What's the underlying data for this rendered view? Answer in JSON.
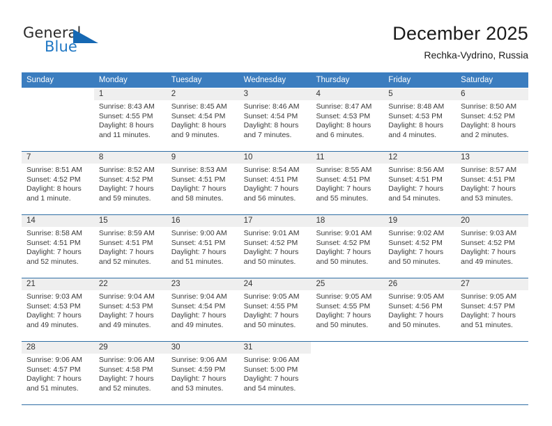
{
  "brand": {
    "word_one": "General",
    "word_two": "Blue",
    "logo_icon": "triangle-logo-icon",
    "accent_color": "#1668b3"
  },
  "header": {
    "title": "December 2025",
    "subtitle": "Rechka-Vydrino, Russia"
  },
  "theme": {
    "header_blue": "#3b7dbf",
    "rule_blue": "#2e6da4",
    "daynum_band": "#efefef",
    "text": "#3a3a3a"
  },
  "weekdays": [
    "Sunday",
    "Monday",
    "Tuesday",
    "Wednesday",
    "Thursday",
    "Friday",
    "Saturday"
  ],
  "weeks": [
    [
      {
        "day": "",
        "sunrise": "",
        "sunset": "",
        "daylight_line1": "",
        "daylight_line2": "",
        "empty": true
      },
      {
        "day": "1",
        "sunrise": "Sunrise: 8:43 AM",
        "sunset": "Sunset: 4:55 PM",
        "daylight_line1": "Daylight: 8 hours",
        "daylight_line2": "and 11 minutes."
      },
      {
        "day": "2",
        "sunrise": "Sunrise: 8:45 AM",
        "sunset": "Sunset: 4:54 PM",
        "daylight_line1": "Daylight: 8 hours",
        "daylight_line2": "and 9 minutes."
      },
      {
        "day": "3",
        "sunrise": "Sunrise: 8:46 AM",
        "sunset": "Sunset: 4:54 PM",
        "daylight_line1": "Daylight: 8 hours",
        "daylight_line2": "and 7 minutes."
      },
      {
        "day": "4",
        "sunrise": "Sunrise: 8:47 AM",
        "sunset": "Sunset: 4:53 PM",
        "daylight_line1": "Daylight: 8 hours",
        "daylight_line2": "and 6 minutes."
      },
      {
        "day": "5",
        "sunrise": "Sunrise: 8:48 AM",
        "sunset": "Sunset: 4:53 PM",
        "daylight_line1": "Daylight: 8 hours",
        "daylight_line2": "and 4 minutes."
      },
      {
        "day": "6",
        "sunrise": "Sunrise: 8:50 AM",
        "sunset": "Sunset: 4:52 PM",
        "daylight_line1": "Daylight: 8 hours",
        "daylight_line2": "and 2 minutes."
      }
    ],
    [
      {
        "day": "7",
        "sunrise": "Sunrise: 8:51 AM",
        "sunset": "Sunset: 4:52 PM",
        "daylight_line1": "Daylight: 8 hours",
        "daylight_line2": "and 1 minute."
      },
      {
        "day": "8",
        "sunrise": "Sunrise: 8:52 AM",
        "sunset": "Sunset: 4:52 PM",
        "daylight_line1": "Daylight: 7 hours",
        "daylight_line2": "and 59 minutes."
      },
      {
        "day": "9",
        "sunrise": "Sunrise: 8:53 AM",
        "sunset": "Sunset: 4:51 PM",
        "daylight_line1": "Daylight: 7 hours",
        "daylight_line2": "and 58 minutes."
      },
      {
        "day": "10",
        "sunrise": "Sunrise: 8:54 AM",
        "sunset": "Sunset: 4:51 PM",
        "daylight_line1": "Daylight: 7 hours",
        "daylight_line2": "and 56 minutes."
      },
      {
        "day": "11",
        "sunrise": "Sunrise: 8:55 AM",
        "sunset": "Sunset: 4:51 PM",
        "daylight_line1": "Daylight: 7 hours",
        "daylight_line2": "and 55 minutes."
      },
      {
        "day": "12",
        "sunrise": "Sunrise: 8:56 AM",
        "sunset": "Sunset: 4:51 PM",
        "daylight_line1": "Daylight: 7 hours",
        "daylight_line2": "and 54 minutes."
      },
      {
        "day": "13",
        "sunrise": "Sunrise: 8:57 AM",
        "sunset": "Sunset: 4:51 PM",
        "daylight_line1": "Daylight: 7 hours",
        "daylight_line2": "and 53 minutes."
      }
    ],
    [
      {
        "day": "14",
        "sunrise": "Sunrise: 8:58 AM",
        "sunset": "Sunset: 4:51 PM",
        "daylight_line1": "Daylight: 7 hours",
        "daylight_line2": "and 52 minutes."
      },
      {
        "day": "15",
        "sunrise": "Sunrise: 8:59 AM",
        "sunset": "Sunset: 4:51 PM",
        "daylight_line1": "Daylight: 7 hours",
        "daylight_line2": "and 52 minutes."
      },
      {
        "day": "16",
        "sunrise": "Sunrise: 9:00 AM",
        "sunset": "Sunset: 4:51 PM",
        "daylight_line1": "Daylight: 7 hours",
        "daylight_line2": "and 51 minutes."
      },
      {
        "day": "17",
        "sunrise": "Sunrise: 9:01 AM",
        "sunset": "Sunset: 4:52 PM",
        "daylight_line1": "Daylight: 7 hours",
        "daylight_line2": "and 50 minutes."
      },
      {
        "day": "18",
        "sunrise": "Sunrise: 9:01 AM",
        "sunset": "Sunset: 4:52 PM",
        "daylight_line1": "Daylight: 7 hours",
        "daylight_line2": "and 50 minutes."
      },
      {
        "day": "19",
        "sunrise": "Sunrise: 9:02 AM",
        "sunset": "Sunset: 4:52 PM",
        "daylight_line1": "Daylight: 7 hours",
        "daylight_line2": "and 50 minutes."
      },
      {
        "day": "20",
        "sunrise": "Sunrise: 9:03 AM",
        "sunset": "Sunset: 4:52 PM",
        "daylight_line1": "Daylight: 7 hours",
        "daylight_line2": "and 49 minutes."
      }
    ],
    [
      {
        "day": "21",
        "sunrise": "Sunrise: 9:03 AM",
        "sunset": "Sunset: 4:53 PM",
        "daylight_line1": "Daylight: 7 hours",
        "daylight_line2": "and 49 minutes."
      },
      {
        "day": "22",
        "sunrise": "Sunrise: 9:04 AM",
        "sunset": "Sunset: 4:53 PM",
        "daylight_line1": "Daylight: 7 hours",
        "daylight_line2": "and 49 minutes."
      },
      {
        "day": "23",
        "sunrise": "Sunrise: 9:04 AM",
        "sunset": "Sunset: 4:54 PM",
        "daylight_line1": "Daylight: 7 hours",
        "daylight_line2": "and 49 minutes."
      },
      {
        "day": "24",
        "sunrise": "Sunrise: 9:05 AM",
        "sunset": "Sunset: 4:55 PM",
        "daylight_line1": "Daylight: 7 hours",
        "daylight_line2": "and 50 minutes."
      },
      {
        "day": "25",
        "sunrise": "Sunrise: 9:05 AM",
        "sunset": "Sunset: 4:55 PM",
        "daylight_line1": "Daylight: 7 hours",
        "daylight_line2": "and 50 minutes."
      },
      {
        "day": "26",
        "sunrise": "Sunrise: 9:05 AM",
        "sunset": "Sunset: 4:56 PM",
        "daylight_line1": "Daylight: 7 hours",
        "daylight_line2": "and 50 minutes."
      },
      {
        "day": "27",
        "sunrise": "Sunrise: 9:05 AM",
        "sunset": "Sunset: 4:57 PM",
        "daylight_line1": "Daylight: 7 hours",
        "daylight_line2": "and 51 minutes."
      }
    ],
    [
      {
        "day": "28",
        "sunrise": "Sunrise: 9:06 AM",
        "sunset": "Sunset: 4:57 PM",
        "daylight_line1": "Daylight: 7 hours",
        "daylight_line2": "and 51 minutes."
      },
      {
        "day": "29",
        "sunrise": "Sunrise: 9:06 AM",
        "sunset": "Sunset: 4:58 PM",
        "daylight_line1": "Daylight: 7 hours",
        "daylight_line2": "and 52 minutes."
      },
      {
        "day": "30",
        "sunrise": "Sunrise: 9:06 AM",
        "sunset": "Sunset: 4:59 PM",
        "daylight_line1": "Daylight: 7 hours",
        "daylight_line2": "and 53 minutes."
      },
      {
        "day": "31",
        "sunrise": "Sunrise: 9:06 AM",
        "sunset": "Sunset: 5:00 PM",
        "daylight_line1": "Daylight: 7 hours",
        "daylight_line2": "and 54 minutes."
      },
      {
        "day": "",
        "sunrise": "",
        "sunset": "",
        "daylight_line1": "",
        "daylight_line2": "",
        "empty": true
      },
      {
        "day": "",
        "sunrise": "",
        "sunset": "",
        "daylight_line1": "",
        "daylight_line2": "",
        "empty": true
      },
      {
        "day": "",
        "sunrise": "",
        "sunset": "",
        "daylight_line1": "",
        "daylight_line2": "",
        "empty": true
      }
    ]
  ]
}
